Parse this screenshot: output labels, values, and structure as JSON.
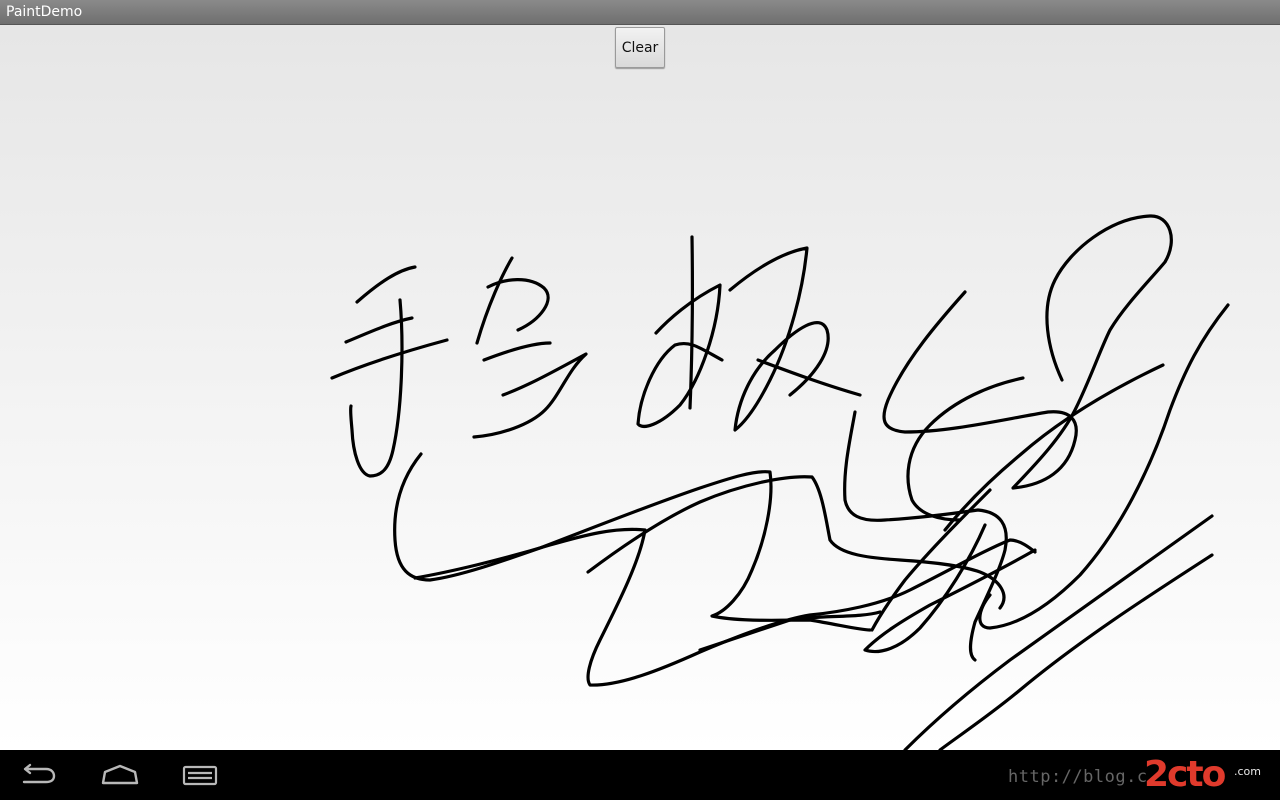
{
  "window": {
    "title": "PaintDemo"
  },
  "toolbar": {
    "clear_label": "Clear"
  },
  "canvas": {
    "stroke_color": "#000000",
    "background": "#f0f0f0"
  },
  "navbar": {
    "back_icon": "back-icon",
    "home_icon": "home-icon",
    "recents_icon": "recent-apps-icon"
  },
  "watermark": {
    "url": "http://blog.c",
    "logo": "2cto",
    "logo_suffix": ".com",
    "logo_color": "#e03a2c"
  },
  "colors": {
    "titlebar": "#7a7a7a",
    "navbar": "#000000",
    "ink": "#000000"
  }
}
